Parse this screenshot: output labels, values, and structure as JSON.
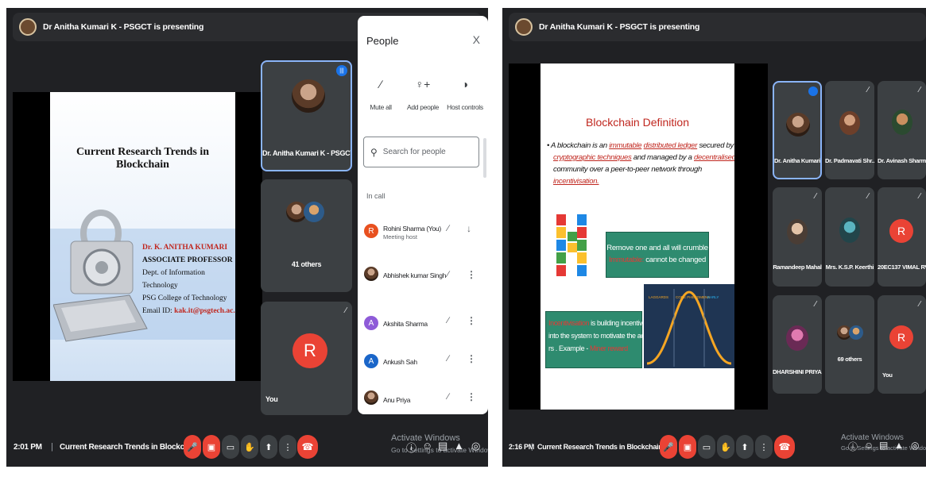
{
  "left": {
    "presenting": "Dr Anitha Kumari K - PSGCT is presenting",
    "slide": {
      "title": "Current Research Trends in Blockchain",
      "author_name": "Dr. K. ANITHA KUMARI",
      "designation": "ASSOCIATE PROFESSOR",
      "department": "Dept. of Information Technology",
      "college": "PSG College of Technology",
      "email_label": "Email ID:",
      "email": "kak.it@psgtech.ac.in"
    },
    "tiles": {
      "presenter_name": "Dr. Anitha Kumari K - PSGCT",
      "others": "41 others",
      "you": "You",
      "you_letter": "R"
    },
    "clock": "2:01 PM",
    "meeting_title": "Current Research Trends in Blockchain",
    "watermark_line1": "Activate Windows",
    "watermark_line2": "Go to Settings to activate Windows."
  },
  "people_panel": {
    "title": "People",
    "close": "X",
    "actions": [
      {
        "label": "Mute all",
        "icon": "mic-off-icon"
      },
      {
        "label": "Add people",
        "icon": "add-person-icon"
      },
      {
        "label": "Host controls",
        "icon": "host-controls-icon"
      }
    ],
    "search_placeholder": "Search for people",
    "section": "In call",
    "participants": [
      {
        "name": "Rohini Sharma (You)",
        "sub": "Meeting host",
        "letter": "R",
        "color": "#e8501f"
      },
      {
        "name": "Abhishek kumar Singh",
        "sub": "",
        "letter": "",
        "color": "#3a2b22"
      },
      {
        "name": "Akshita Sharma",
        "sub": "",
        "letter": "A",
        "color": "#8e5bd8"
      },
      {
        "name": "Ankush Sah",
        "sub": "",
        "letter": "A",
        "color": "#1a66c9"
      },
      {
        "name": "Anu Priya",
        "sub": "",
        "letter": "",
        "color": "#8a5a4a"
      }
    ]
  },
  "right": {
    "presenting": "Dr Anitha Kumari K - PSGCT is presenting",
    "slide": {
      "title": "Blockchain Definition",
      "definition_a": "A blockchain is an ",
      "definition_b": "immutable",
      "definition_c": " ",
      "definition_d": "distributed ledger",
      "definition_e": " secured by",
      "definition_f": "cryptographic techniques",
      "definition_g": " and managed by a ",
      "definition_h": "decentralised",
      "definition_i": "community over a peer-to-peer network through",
      "definition_j": "incentivisation.",
      "box1_line1": "Remove one and all will crumble",
      "box1_word": "Immutable:",
      "box1_line2": " cannot be changed",
      "box2_word": "Incentivisation",
      "box2_line1": " is building incentives",
      "box2_line2": "into the system to motivate the acto",
      "box2_line3": "rs . Example - ",
      "box2_example": "Miner reward",
      "chart_labels": [
        "LAGGARDS",
        "CORE PHENOMENA",
        "EARLY"
      ]
    },
    "tiles": [
      {
        "name": "Dr. Anitha Kumari ...",
        "type": "photo",
        "muted": false
      },
      {
        "name": "Dr. Padmavati Shr...",
        "type": "photo",
        "muted": true
      },
      {
        "name": "Dr. Avinash Sharma",
        "type": "photo",
        "muted": true
      },
      {
        "name": "Ramandeep Mahal",
        "type": "photo",
        "muted": true
      },
      {
        "name": "Mrs. K.S.P. Keerthi",
        "type": "photo",
        "muted": true
      },
      {
        "name": "20EC137 VIMAL RV",
        "type": "letter",
        "letter": "R",
        "muted": true
      },
      {
        "name": "DHARSHINI PRIYA R",
        "type": "photo",
        "muted": true
      },
      {
        "name": "69 others",
        "type": "group",
        "muted": false
      },
      {
        "name": "You",
        "type": "letter",
        "letter": "R",
        "muted": true
      }
    ],
    "clock": "2:16 PM",
    "meeting_title": "Current Research Trends in Blockchain",
    "watermark_line1": "Activate Windows",
    "watermark_line2": "Go to Settings to activate Windows."
  }
}
